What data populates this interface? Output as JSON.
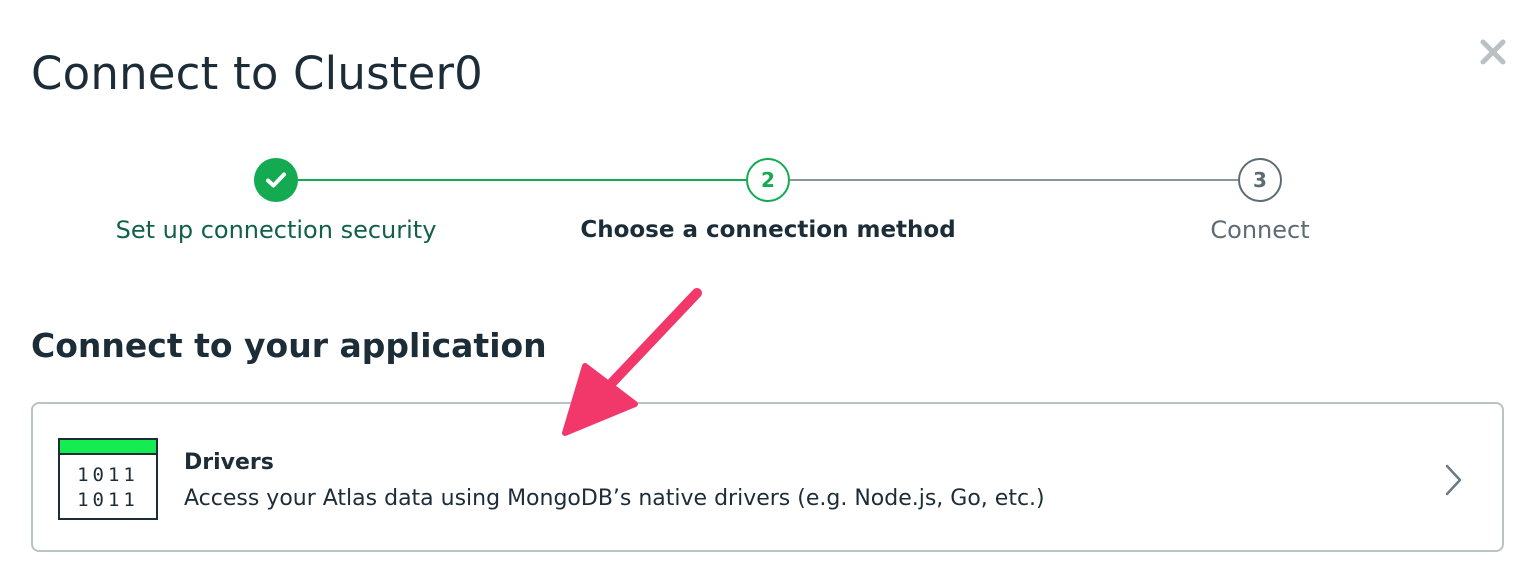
{
  "modal": {
    "title": "Connect to Cluster0",
    "close_icon": "close-icon"
  },
  "stepper": {
    "steps": [
      {
        "number": "1",
        "label": "Set up connection security",
        "state": "complete",
        "icon": "check-icon"
      },
      {
        "number": "2",
        "label": "Choose a connection method",
        "state": "active"
      },
      {
        "number": "3",
        "label": "Connect",
        "state": "upcoming"
      }
    ]
  },
  "section": {
    "title": "Connect to your application"
  },
  "options": [
    {
      "name": "Drivers",
      "description": "Access your Atlas data using MongoDB’s native drivers (e.g. Node.js, Go, etc.)",
      "icon": "drivers-binary-icon",
      "icon_text": [
        "1011",
        "1011"
      ],
      "chevron": "chevron-right-icon"
    }
  ],
  "annotation": {
    "icon": "pointer-arrow-icon",
    "color": "#f2386b"
  },
  "colors": {
    "primary_green": "#13aa52",
    "dark_green": "#116149",
    "text_dark": "#1c2d38",
    "text_muted": "#5d6c74",
    "border": "#b8c4c2"
  }
}
